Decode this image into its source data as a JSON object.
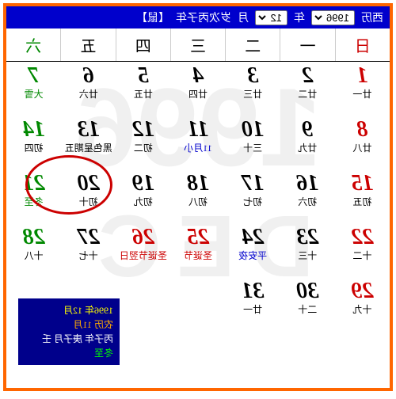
{
  "header": {
    "era_label": "西历",
    "year": "1996",
    "year_suffix": "年",
    "month": "12",
    "month_suffix": "月",
    "ganzhi": "岁次丙子年",
    "category": "【鼠】"
  },
  "weekdays": [
    "日",
    "一",
    "二",
    "三",
    "四",
    "五",
    "六"
  ],
  "bg": {
    "year": "1996",
    "month": "DEC"
  },
  "rows": [
    [
      {
        "n": "1",
        "s": "廿一",
        "cls": "red"
      },
      {
        "n": "2",
        "s": "廿二"
      },
      {
        "n": "3",
        "s": "廿三"
      },
      {
        "n": "4",
        "s": "廿四"
      },
      {
        "n": "5",
        "s": "廿五"
      },
      {
        "n": "6",
        "s": "廿六"
      },
      {
        "n": "7",
        "s": "大雪",
        "cls": "green",
        "scls": "green"
      }
    ],
    [
      {
        "n": "8",
        "s": "廿八",
        "cls": "red"
      },
      {
        "n": "9",
        "s": "廿九"
      },
      {
        "n": "10",
        "s": "三十"
      },
      {
        "n": "11",
        "s": "11月小",
        "scls": "blue"
      },
      {
        "n": "12",
        "s": "初二"
      },
      {
        "n": "13",
        "s": "黑色星期五"
      },
      {
        "n": "14",
        "s": "初四",
        "cls": "green"
      }
    ],
    [
      {
        "n": "15",
        "s": "初五",
        "cls": "red"
      },
      {
        "n": "16",
        "s": "初六"
      },
      {
        "n": "17",
        "s": "初七"
      },
      {
        "n": "18",
        "s": "初八"
      },
      {
        "n": "19",
        "s": "初九"
      },
      {
        "n": "20",
        "s": "初十"
      },
      {
        "n": "21",
        "s": "冬至",
        "cls": "green",
        "scls": "green"
      }
    ],
    [
      {
        "n": "22",
        "s": "十二",
        "cls": "red"
      },
      {
        "n": "23",
        "s": "十三"
      },
      {
        "n": "24",
        "s": "平安夜",
        "scls": "blue"
      },
      {
        "n": "25",
        "s": "圣诞节",
        "cls": "red",
        "scls": "red"
      },
      {
        "n": "26",
        "s": "圣诞节翌日",
        "cls": "red",
        "scls": "red"
      },
      {
        "n": "27",
        "s": "十七"
      },
      {
        "n": "28",
        "s": "十八",
        "cls": "green"
      }
    ],
    [
      {
        "n": "29",
        "s": "十九",
        "cls": "red"
      },
      {
        "n": "30",
        "s": "二十"
      },
      {
        "n": "31",
        "s": "廿一"
      },
      {},
      {},
      {},
      {}
    ]
  ],
  "tooltip": {
    "line1": "1996年 12月",
    "line2": "农历 11月",
    "line3": "丙子年 庚子月 壬",
    "line4": "冬至"
  }
}
